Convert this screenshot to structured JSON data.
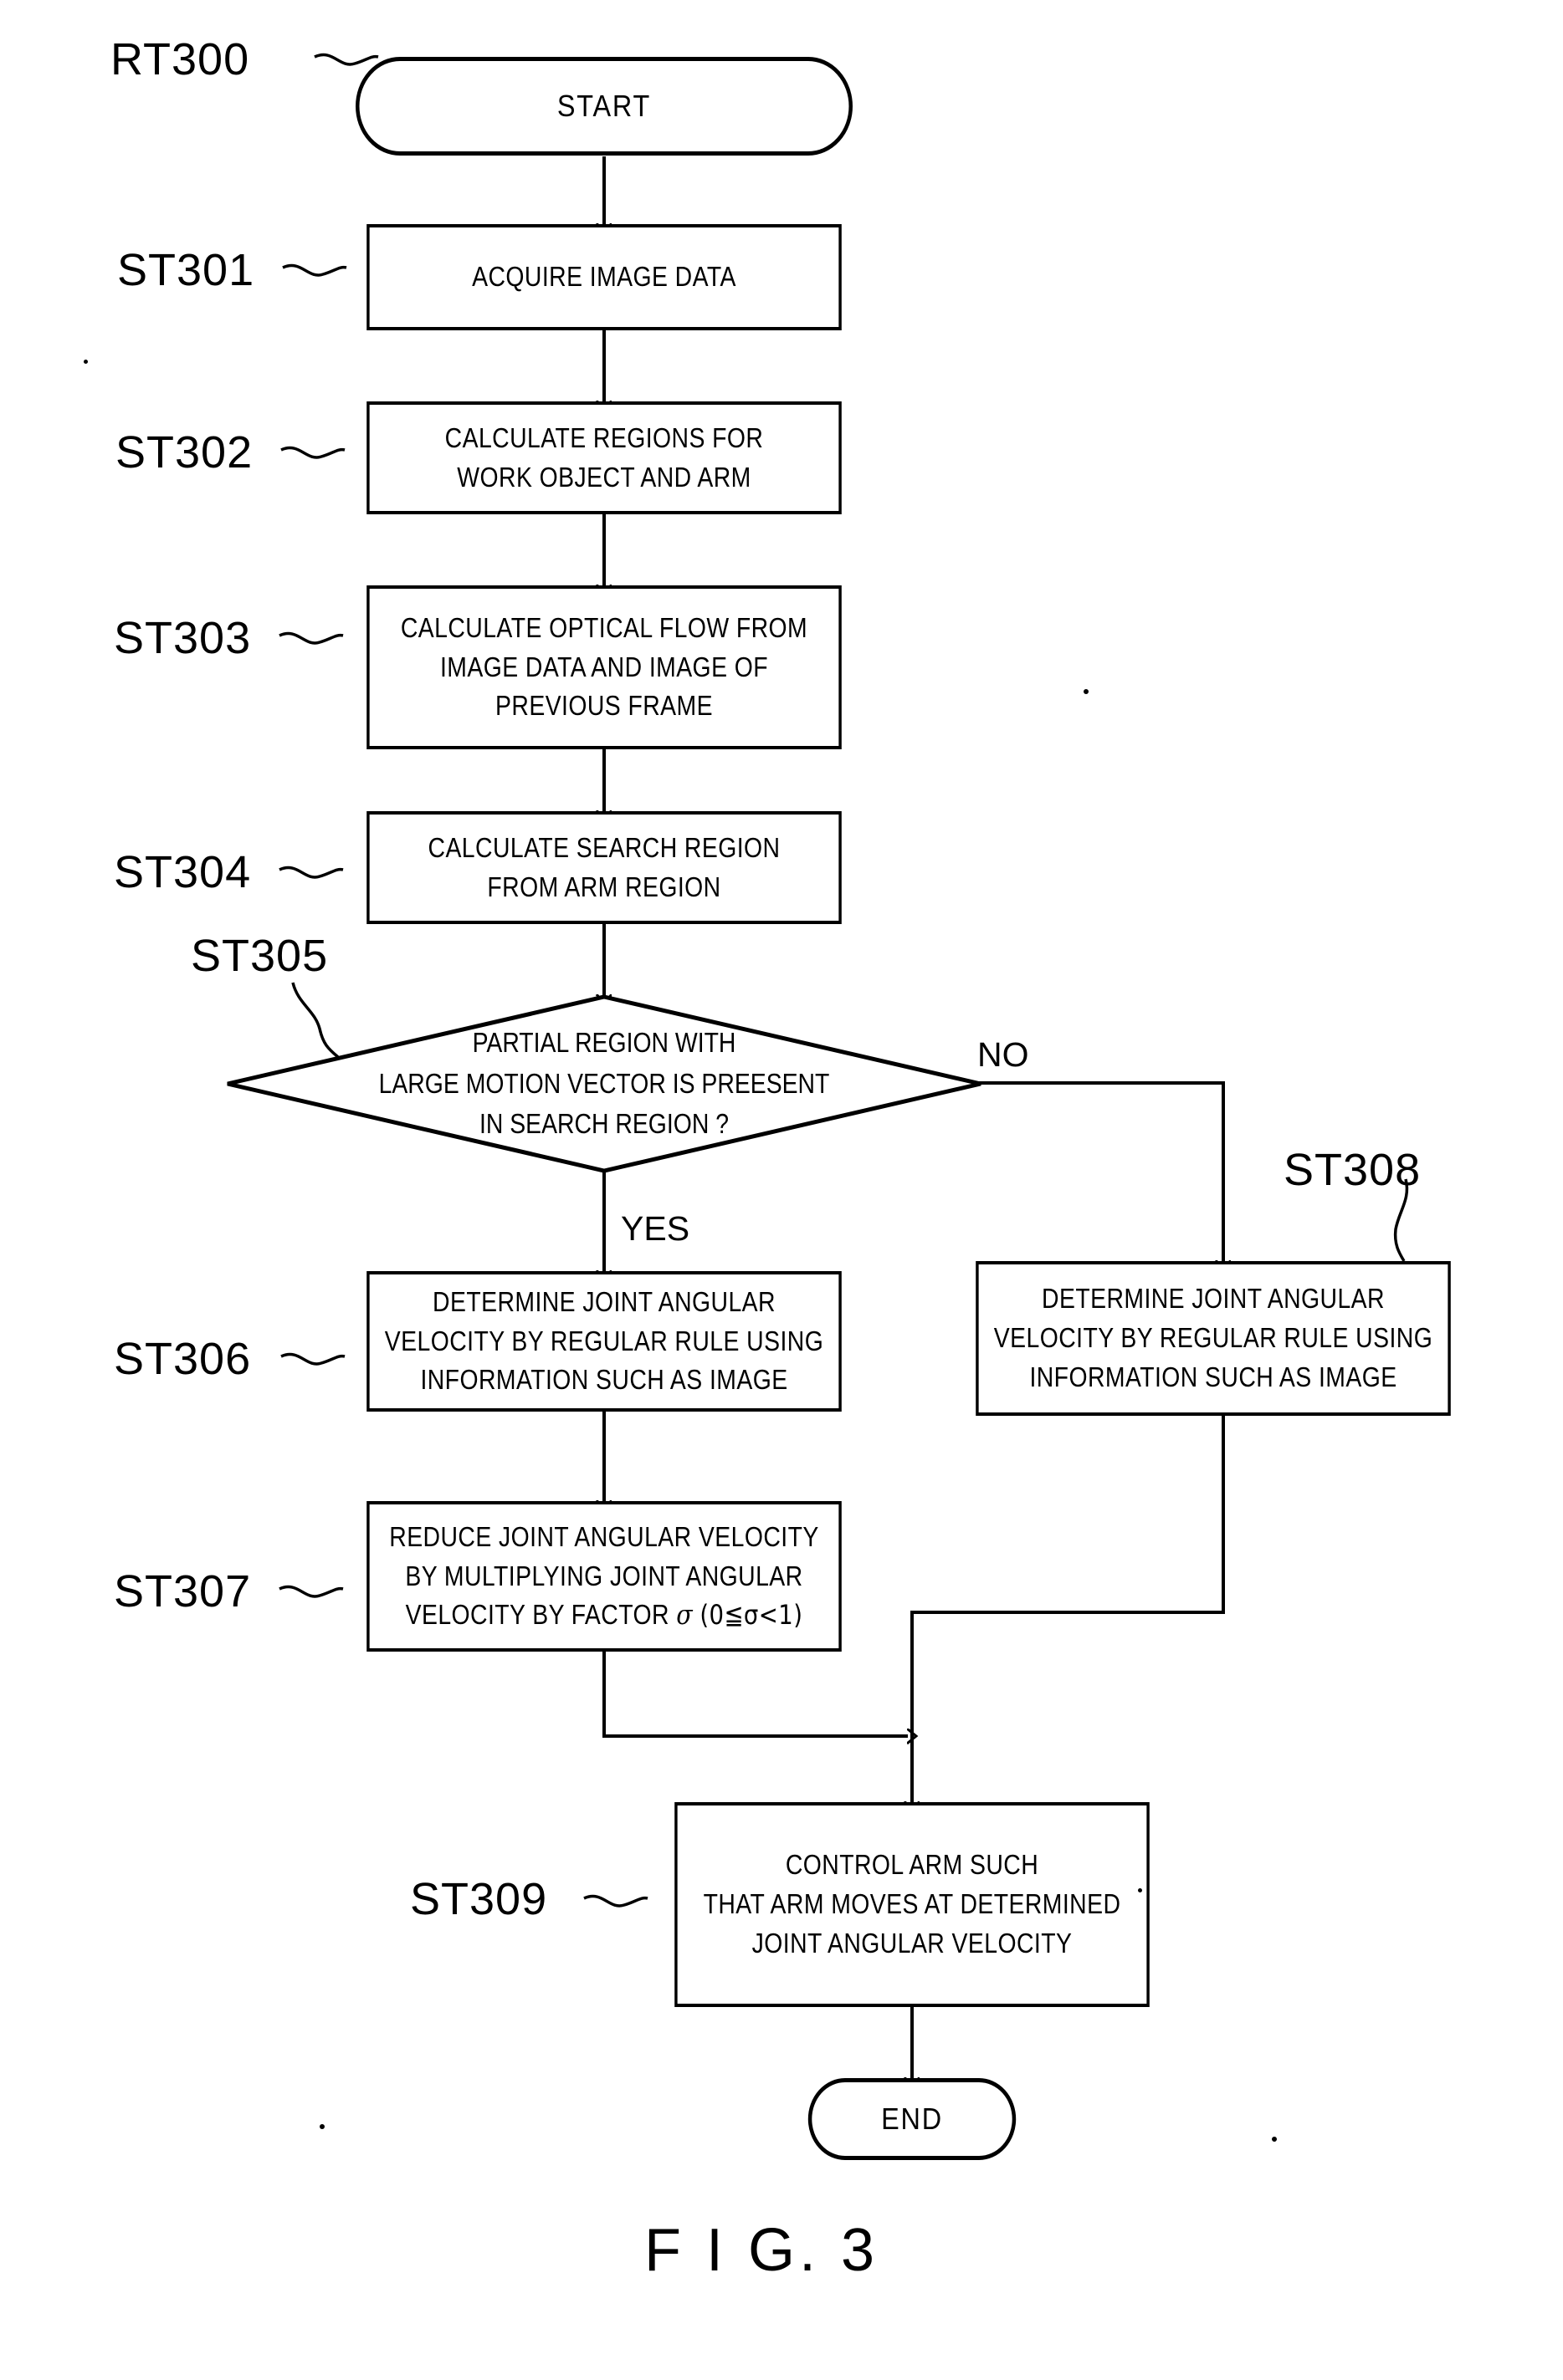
{
  "figure": {
    "caption": "F I G. 3"
  },
  "nodes": {
    "start": {
      "ref": "RT300",
      "label": "START"
    },
    "st301": {
      "ref": "ST301",
      "lines": [
        "ACQUIRE IMAGE DATA"
      ]
    },
    "st302": {
      "ref": "ST302",
      "lines": [
        "CALCULATE REGIONS FOR",
        "WORK OBJECT AND ARM"
      ]
    },
    "st303": {
      "ref": "ST303",
      "lines": [
        "CALCULATE OPTICAL FLOW FROM",
        "IMAGE DATA AND IMAGE OF",
        "PREVIOUS FRAME"
      ]
    },
    "st304": {
      "ref": "ST304",
      "lines": [
        "CALCULATE SEARCH REGION",
        "FROM ARM REGION"
      ]
    },
    "st305": {
      "ref": "ST305",
      "lines": [
        "PARTIAL REGION WITH",
        "LARGE MOTION VECTOR IS PREESENT",
        "IN SEARCH REGION ?"
      ],
      "yes_label": "YES",
      "no_label": "NO"
    },
    "st306": {
      "ref": "ST306",
      "lines": [
        "DETERMINE JOINT ANGULAR",
        "VELOCITY BY REGULAR RULE USING",
        "INFORMATION SUCH AS IMAGE"
      ]
    },
    "st307": {
      "ref": "ST307",
      "lines": [
        "REDUCE JOINT ANGULAR VELOCITY",
        "BY MULTIPLYING JOINT ANGULAR",
        "VELOCITY BY FACTOR"
      ],
      "formula_sigma": "σ",
      "formula_range": "(0≦σ<1)"
    },
    "st308": {
      "ref": "ST308",
      "lines": [
        "DETERMINE JOINT ANGULAR",
        "VELOCITY BY REGULAR RULE USING",
        "INFORMATION SUCH AS IMAGE"
      ]
    },
    "st309": {
      "ref": "ST309",
      "lines": [
        "CONTROL ARM SUCH",
        "THAT ARM MOVES AT DETERMINED",
        "JOINT ANGULAR VELOCITY"
      ]
    },
    "end": {
      "label": "END"
    }
  },
  "colors": {
    "ink": "#000000",
    "paper": "#ffffff"
  }
}
